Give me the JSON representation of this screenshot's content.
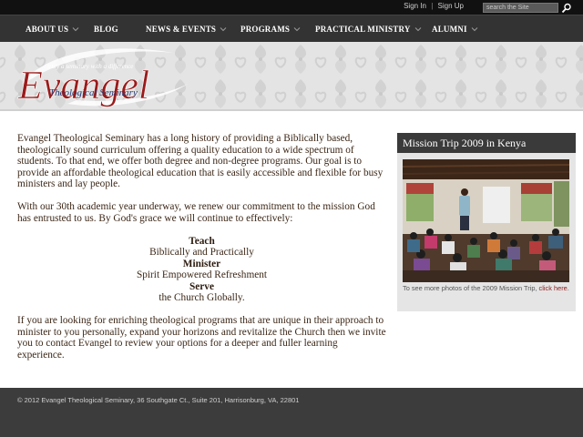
{
  "topbar": {
    "sign_in": "Sign In",
    "separator": "|",
    "sign_up": "Sign Up",
    "search_placeholder": "search the Site"
  },
  "nav": {
    "items": [
      {
        "label": "ABOUT US",
        "has_dropdown": true
      },
      {
        "label": "BLOG",
        "has_dropdown": false
      },
      {
        "label": "NEWS & EVENTS",
        "has_dropdown": true
      },
      {
        "label": "PROGRAMS",
        "has_dropdown": true
      },
      {
        "label": "PRACTICAL MINISTRY",
        "has_dropdown": true
      },
      {
        "label": "ALUMNI",
        "has_dropdown": true
      }
    ]
  },
  "logo": {
    "tagline": "truly a seminary with a difference",
    "name": "Evangel",
    "subtitle": "Theological Seminary"
  },
  "main": {
    "para1": "Evangel Theological Seminary has a long history of providing a Biblically based, theologically sound curriculum offering a quality education to a wide spectrum of students. To that end, we offer both degree and non-degree programs. Our goal is to provide an affordable theological education that is easily accessible and flexible for busy ministers and lay people.",
    "para2": "With our 30th academic year underway, we renew our commitment to the mission God has entrusted to us. By God's grace we will continue to effectively:",
    "mission": {
      "teach": "Teach",
      "teach_desc": "Biblically and Practically",
      "minister": "Minister",
      "minister_desc": "Spirit Empowered Refreshment",
      "serve": "Serve",
      "serve_desc": "the Church Globally."
    },
    "para3": "If you are looking for enriching theological programs that are unique in their approach to minister to you personally, expand your horizons and revitalize the Church then we invite you to contact Evangel to review your options for a deeper and fuller learning experience."
  },
  "sidebar": {
    "title": "Mission Trip 2009 in Kenya",
    "caption": "To see more photos of the 2009 Mission Trip,",
    "caption_link": "click here",
    "caption_end": "."
  },
  "footer": {
    "text": "© 2012 Evangel Theological Seminary, 36 Southgate Ct., Suite 201, Harrisonburg, VA, 22801"
  },
  "colors": {
    "nav_bg": "#333333",
    "topbar_bg": "#111111",
    "logo_red": "#9a1b1b",
    "logo_blue": "#2a3a73",
    "link_red": "#8b1a1a",
    "footer_bg": "#3c3c3c"
  }
}
